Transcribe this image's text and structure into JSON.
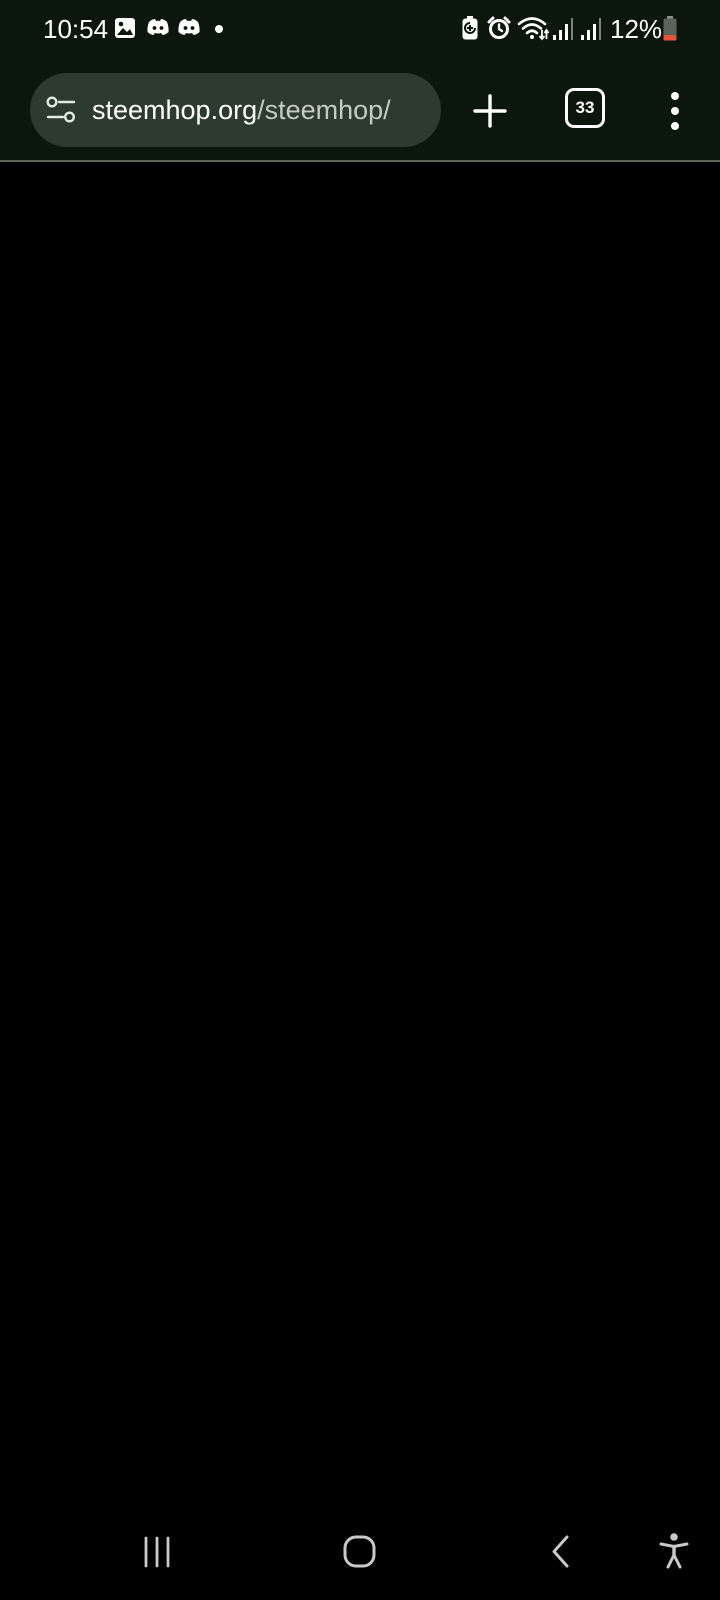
{
  "status_bar": {
    "time": "10:54",
    "battery_percent": "12%",
    "notification_icons": [
      "image-icon",
      "discord-icon",
      "discord-icon",
      "dot-icon"
    ],
    "system_icons": [
      "battery-saver-icon",
      "alarm-icon",
      "wifi-icon",
      "signal-icon",
      "signal-icon",
      "battery-icon"
    ],
    "battery_low_color": "#e8533a"
  },
  "browser": {
    "url_host": "steemhop.org",
    "url_path": "/steemhop/",
    "tab_count": "33",
    "toolbar_color": "#0b160d",
    "url_bar_color": "#2d3a2f"
  },
  "navigation_bar": {
    "buttons": [
      "recents-icon",
      "home-icon",
      "back-icon",
      "accessibility-icon"
    ]
  }
}
